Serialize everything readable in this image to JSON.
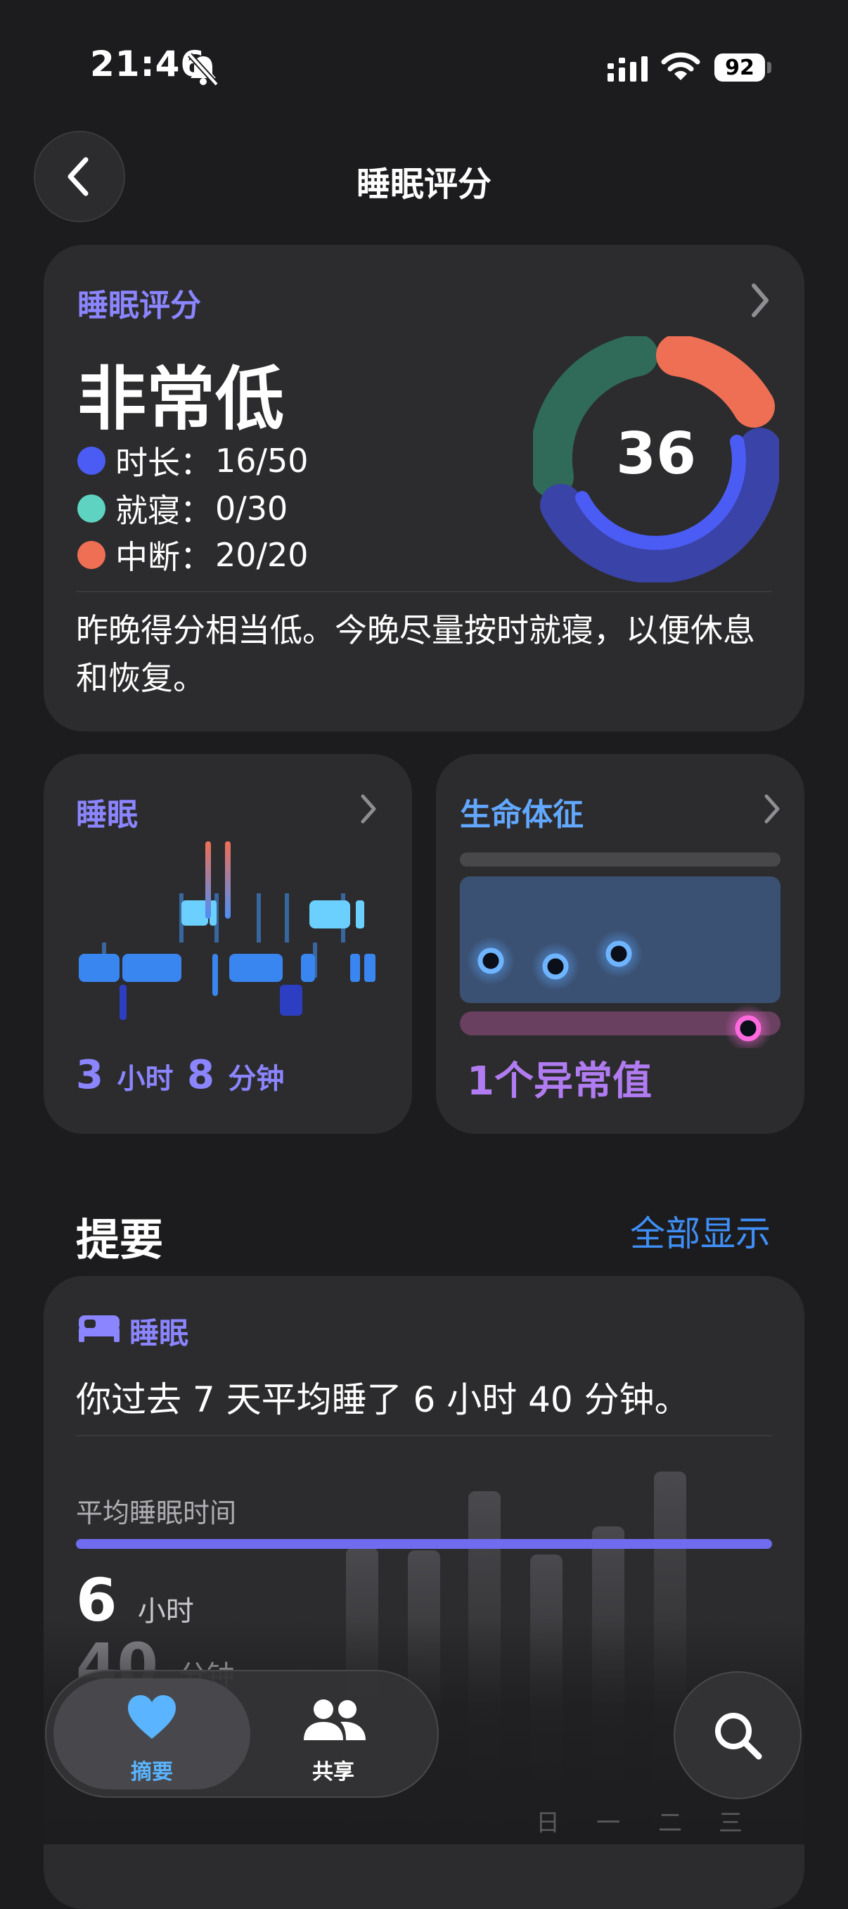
{
  "status_bar": {
    "time": "21:46",
    "battery": "92"
  },
  "nav": {
    "title": "睡眠评分"
  },
  "score_card": {
    "label": "睡眠评分",
    "level": "非常低",
    "score": "36",
    "legend": [
      {
        "name": "时长：",
        "value": "16/50",
        "color": "#4b5cf5"
      },
      {
        "name": "就寝：",
        "value": "0/30",
        "color": "#5fd3c1"
      },
      {
        "name": "中断：",
        "value": "20/20",
        "color": "#ef6f55"
      }
    ],
    "summary": "昨晚得分相当低。今晚尽量按时就寝，以便休息和恢复。"
  },
  "sleep_card": {
    "label": "睡眠",
    "duration_hours": "3",
    "hours_unit": "小时",
    "duration_minutes": "8",
    "minutes_unit": "分钟"
  },
  "vitals_card": {
    "label": "生命体征",
    "outlier_text": "1个异常值"
  },
  "highlights": {
    "title": "提要",
    "show_all": "全部显示",
    "sleep_label": "睡眠",
    "text": "你过去 7 天平均睡了 6 小时 40 分钟。",
    "avg_label": "平均睡眠时间",
    "avg_hours": "6",
    "avg_hours_unit": "小时",
    "avg_minutes": "40",
    "avg_minutes_unit": "分钟",
    "weekdays": [
      "日",
      "一",
      "二",
      "三"
    ]
  },
  "tabbar": {
    "summary": "摘要",
    "sharing": "共享"
  },
  "colors": {
    "accent_purple": "#8b85ff",
    "accent_blue": "#3f8ff7",
    "duration": "#4b5cf5",
    "bedtime": "#2f6b58",
    "interruption": "#ef6f55"
  }
}
